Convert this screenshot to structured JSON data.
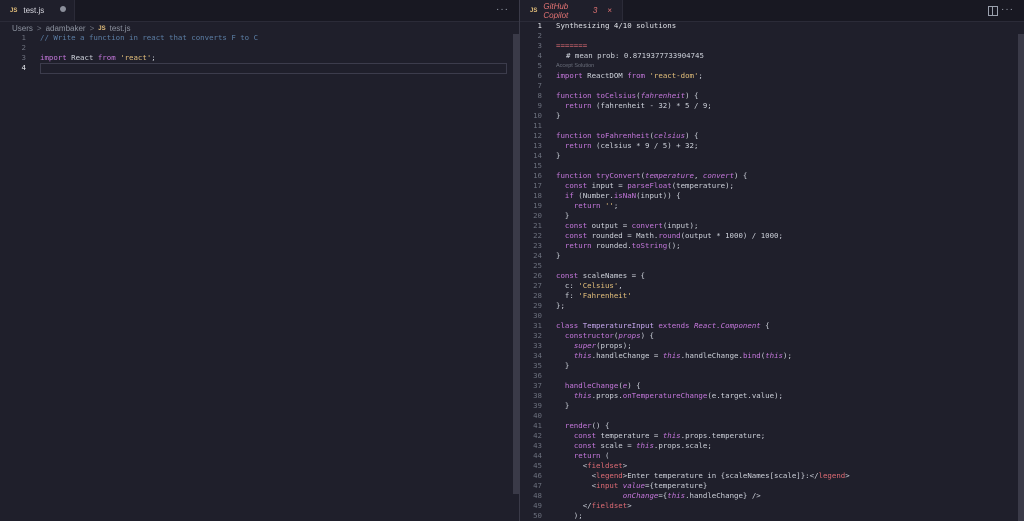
{
  "left": {
    "tab": {
      "icon": "JS",
      "label": "test.js"
    },
    "more": "···",
    "breadcrumb": {
      "p1": "Users",
      "p2": "adambaker",
      "icon": "JS",
      "file": "test.js"
    },
    "lines": [
      "1",
      "2",
      "3",
      "4"
    ],
    "code": {
      "l1": "// Write a function in react that converts F to C",
      "l3_kw": "import",
      "l3_name": " React ",
      "l3_from": "from",
      "l3_str": " 'react'",
      "l3_semi": ";"
    }
  },
  "right": {
    "tab": {
      "icon": "JS",
      "label": "GitHub Copilot",
      "count": "3",
      "close": "×"
    },
    "more": "···",
    "header": "Synthesizing 4/10 solutions",
    "separator": "=======",
    "mean_prob": "# mean prob: 0.8719377733904745",
    "accept": "Accept Solution",
    "line_numbers": [
      "1",
      "2",
      "3",
      "4",
      "5",
      "6",
      "7",
      "8",
      "9",
      "10",
      "11",
      "12",
      "13",
      "14",
      "15",
      "16",
      "17",
      "18",
      "19",
      "20",
      "21",
      "22",
      "23",
      "24",
      "25",
      "26",
      "27",
      "28",
      "29",
      "30",
      "31",
      "32",
      "33",
      "34",
      "35",
      "36",
      "37",
      "38",
      "39",
      "40",
      "41",
      "42",
      "43",
      "44",
      "45",
      "46",
      "47",
      "48",
      "49",
      "50"
    ]
  }
}
